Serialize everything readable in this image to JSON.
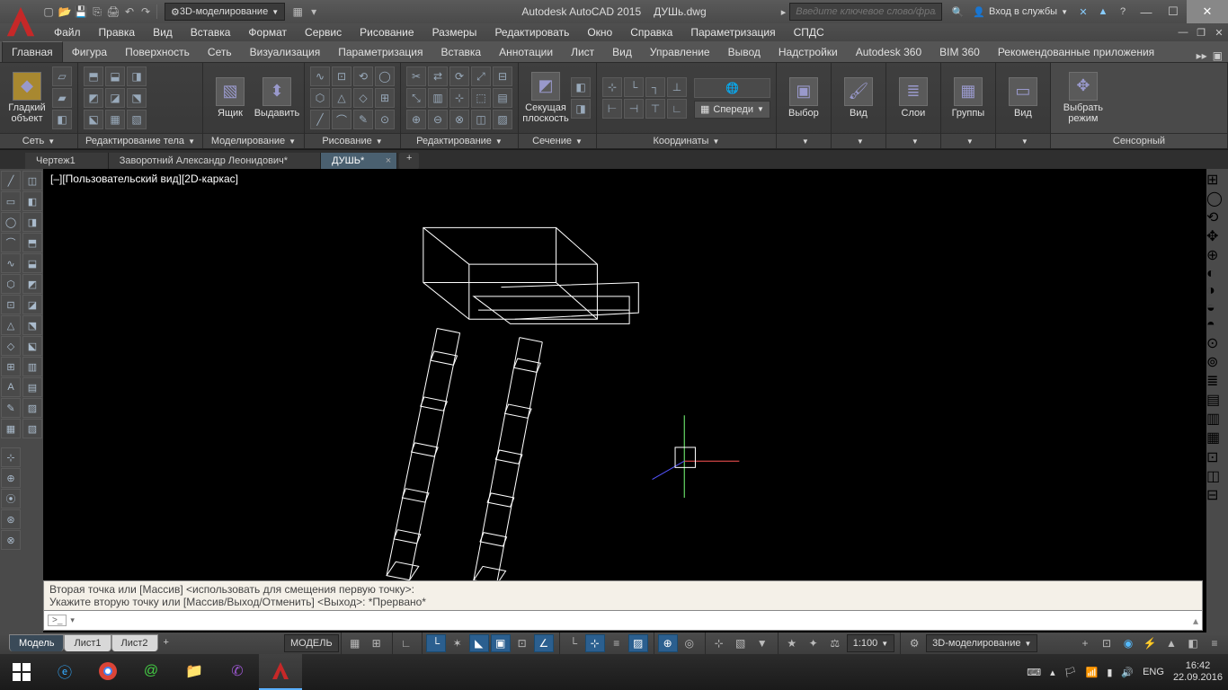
{
  "title": {
    "app": "Autodesk AutoCAD 2015",
    "file": "ДУШь.dwg"
  },
  "search": {
    "placeholder": "Введите ключевое слово/фразу"
  },
  "signin": {
    "label": "Вход в службы"
  },
  "workspace": {
    "label": "3D-моделирование"
  },
  "menu": [
    "Файл",
    "Правка",
    "Вид",
    "Вставка",
    "Формат",
    "Сервис",
    "Рисование",
    "Размеры",
    "Редактировать",
    "Окно",
    "Справка",
    "Параметризация",
    "СПДС"
  ],
  "ribbonTabs": [
    "Главная",
    "Фигура",
    "Поверхность",
    "Сеть",
    "Визуализация",
    "Параметризация",
    "Вставка",
    "Аннотации",
    "Лист",
    "Вид",
    "Управление",
    "Вывод",
    "Надстройки",
    "Autodesk 360",
    "BIM 360",
    "Рекомендованные приложения"
  ],
  "ribbonActive": 0,
  "panels": {
    "p1": {
      "title": "Сеть",
      "btn": "Гладкий объект"
    },
    "p2": {
      "title": "Редактирование тела"
    },
    "p3": {
      "title": "Моделирование",
      "btn1": "Ящик",
      "btn2": "Выдавить"
    },
    "p4": {
      "title": "Рисование"
    },
    "p5": {
      "title": "Редактирование"
    },
    "p6": {
      "title": "Сечение",
      "btn": "Секущая плоскость"
    },
    "p7": {
      "title": "Координаты",
      "view": "Спереди"
    },
    "p8": {
      "btn": "Выбор"
    },
    "p9": {
      "btn": "Вид"
    },
    "p10": {
      "btn": "Слои"
    },
    "p11": {
      "btn": "Группы"
    },
    "p12": {
      "btn": "Вид"
    },
    "p13": {
      "title": "Сенсорный",
      "btn": "Выбрать режим"
    }
  },
  "docTabs": [
    {
      "label": "Чертеж1",
      "active": false
    },
    {
      "label": "Заворотний Александр Леонидович*",
      "active": false
    },
    {
      "label": "ДУШЬ*",
      "active": true
    }
  ],
  "viewport": {
    "label": "[–][Пользовательский вид][2D-каркас]"
  },
  "cmd": {
    "line1": "Вторая точка или [Массив] <использовать для смещения первую точку>:",
    "line2": "Укажите вторую точку или [Массив/Выход/Отменить] <Выход>: *Прервано*",
    "prompt": ">_"
  },
  "layoutTabs": [
    {
      "label": "Модель",
      "active": true
    },
    {
      "label": "Лист1",
      "active": false
    },
    {
      "label": "Лист2",
      "active": false
    }
  ],
  "status": {
    "model": "МОДЕЛЬ",
    "scale": "1:100",
    "ws": "3D-моделирование"
  },
  "tray": {
    "lang": "ENG",
    "time": "16:42",
    "date": "22.09.2016"
  }
}
